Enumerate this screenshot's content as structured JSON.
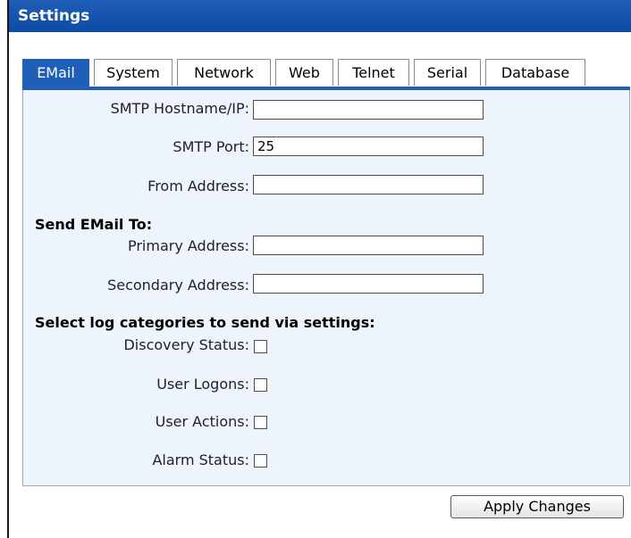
{
  "window": {
    "title": "Settings"
  },
  "tabs": [
    {
      "label": "EMail",
      "active": true
    },
    {
      "label": "System",
      "active": false
    },
    {
      "label": "Network",
      "active": false
    },
    {
      "label": "Web",
      "active": false
    },
    {
      "label": "Telnet",
      "active": false
    },
    {
      "label": "Serial",
      "active": false
    },
    {
      "label": "Database",
      "active": false
    }
  ],
  "email": {
    "smtp_host": {
      "label": "SMTP Hostname/IP:",
      "value": ""
    },
    "smtp_port": {
      "label": "SMTP Port:",
      "value": "25"
    },
    "from_address": {
      "label": "From Address:",
      "value": ""
    },
    "send_to_heading": "Send EMail To:",
    "primary_address": {
      "label": "Primary Address:",
      "value": ""
    },
    "secondary_address": {
      "label": "Secondary Address:",
      "value": ""
    },
    "log_categories_heading": "Select log categories to send via settings:",
    "categories": [
      {
        "label": "Discovery Status:",
        "checked": false
      },
      {
        "label": "User Logons:",
        "checked": false
      },
      {
        "label": "User Actions:",
        "checked": false
      },
      {
        "label": "Alarm Status:",
        "checked": false
      }
    ]
  },
  "footer": {
    "apply_label": "Apply Changes"
  },
  "colors": {
    "accent": "#1f5fb8",
    "panel_background": "#eef4fc"
  }
}
